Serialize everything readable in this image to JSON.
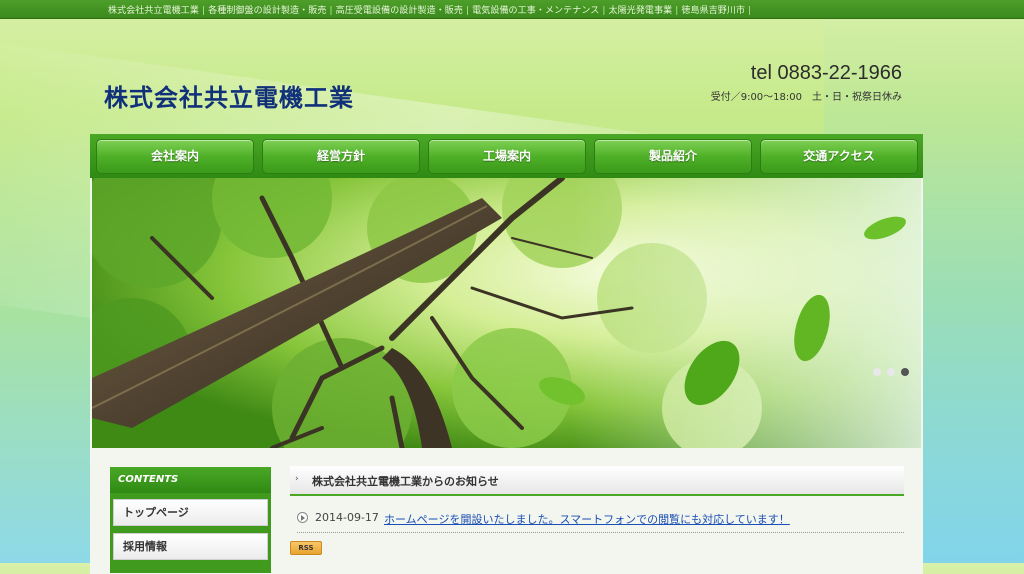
{
  "top_strip": {
    "items": [
      "株式会社共立電機工業",
      "各種制御盤の設計製造・販売",
      "高圧受電設備の設計製造・販売",
      "電気設備の工事・メンテナンス",
      "太陽光発電事業",
      "徳島県吉野川市"
    ]
  },
  "header": {
    "logo": "株式会社共立電機工業",
    "tel": "tel 0883-22-1966",
    "hours": "受付／9:00〜18:00　土・日・祝祭日休み"
  },
  "nav": {
    "items": [
      {
        "label": "会社案内"
      },
      {
        "label": "経営方針"
      },
      {
        "label": "工場案内"
      },
      {
        "label": "製品紹介"
      },
      {
        "label": "交通アクセス"
      }
    ]
  },
  "slider": {
    "dot_count": 3,
    "active_index": 2
  },
  "sidebar": {
    "heading": "CONTENTS",
    "items": [
      {
        "label": "トップページ"
      },
      {
        "label": "採用情報"
      }
    ]
  },
  "news": {
    "heading": "株式会社共立電機工業からのお知らせ",
    "items": [
      {
        "date": "2014-09-17",
        "text": "ホームページを開設いたしました。スマートフォンでの閲覧にも対応しています！"
      }
    ],
    "rss_label": "RSS"
  },
  "colors": {
    "brand_green": "#3f9a1d",
    "logo_navy": "#10317a",
    "link_blue": "#1a4fb5"
  }
}
